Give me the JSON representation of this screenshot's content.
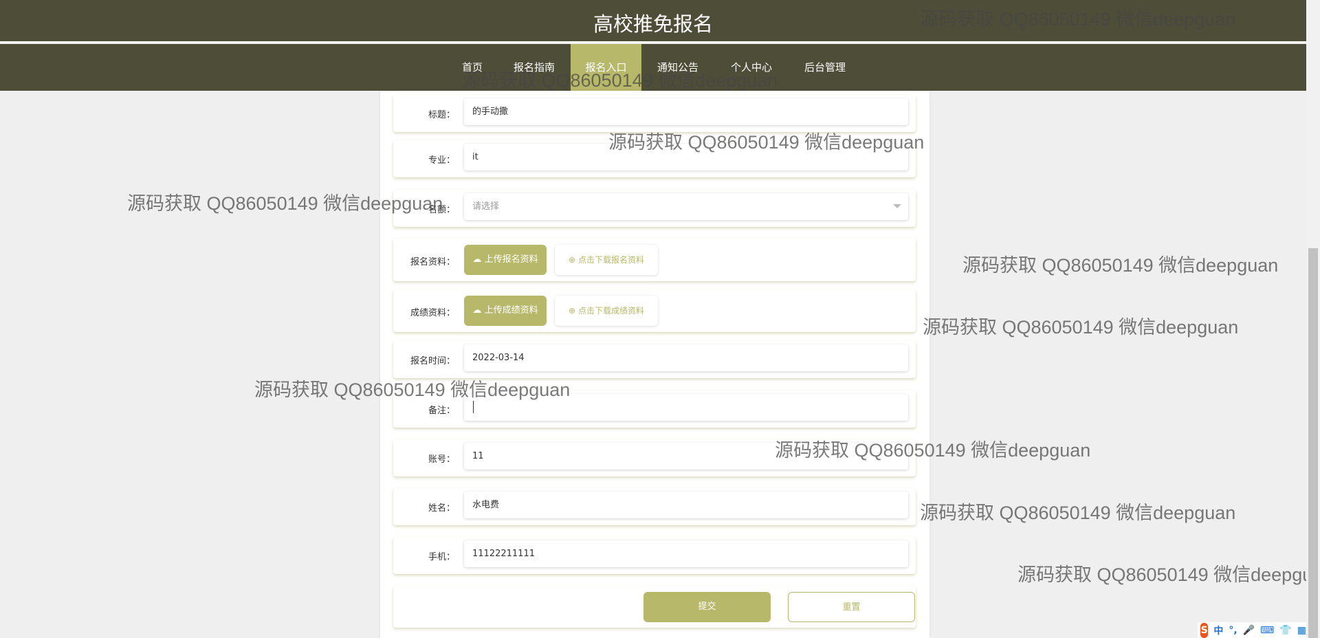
{
  "header": {
    "title": "高校推免报名"
  },
  "nav": {
    "items": [
      {
        "label": "首页"
      },
      {
        "label": "报名指南"
      },
      {
        "label": "报名入口",
        "active": true
      },
      {
        "label": "通知公告"
      },
      {
        "label": "个人中心"
      },
      {
        "label": "后台管理"
      }
    ]
  },
  "form": {
    "title": {
      "label": "标题：",
      "value": "的手动撒"
    },
    "major": {
      "label": "专业：",
      "value": "it"
    },
    "quota": {
      "label": "名额：",
      "placeholder": "请选择"
    },
    "apply_file": {
      "label": "报名资料：",
      "upload": "上传报名资料",
      "download": "点击下载报名资料"
    },
    "score_file": {
      "label": "成绩资料：",
      "upload": "上传成绩资料",
      "download": "点击下载成绩资料"
    },
    "apply_time": {
      "label": "报名时间：",
      "value": "2022-03-14"
    },
    "remark": {
      "label": "备注：",
      "value": ""
    },
    "account": {
      "label": "账号：",
      "value": "11"
    },
    "name": {
      "label": "姓名：",
      "value": "水电费"
    },
    "phone": {
      "label": "手机：",
      "value": "11122211111"
    },
    "submit": "提交",
    "reset": "重置"
  },
  "watermark": "源码获取 QQ86050149 微信deepguan",
  "ime": {
    "lang": "中",
    "punct": "°,"
  },
  "colors": {
    "header": "#4d4d38",
    "accent": "#b8b86a",
    "background": "#efefef"
  }
}
